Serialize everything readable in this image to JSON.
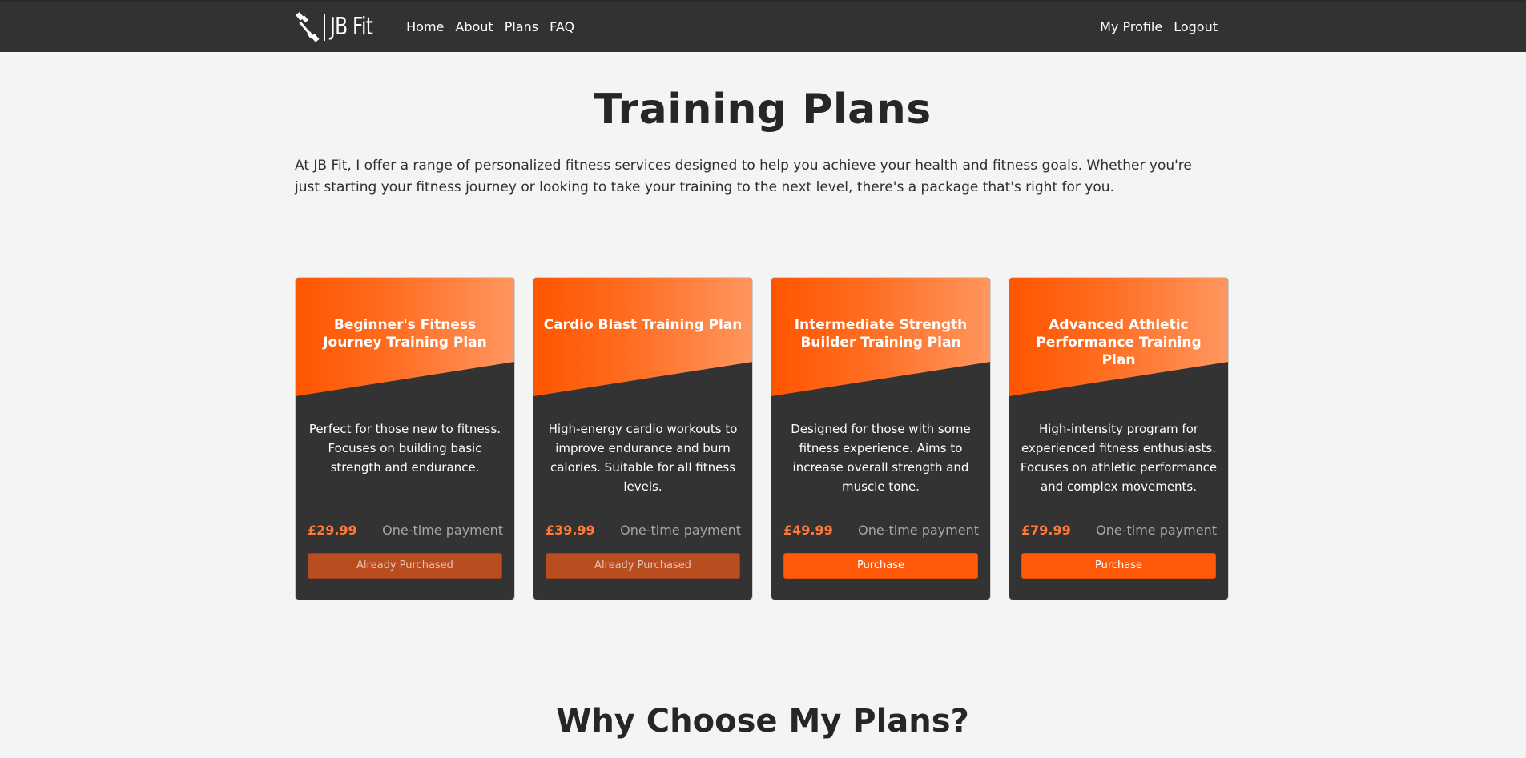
{
  "nav": {
    "logo_text": "JB Fit",
    "links": [
      "Home",
      "About",
      "Plans",
      "FAQ"
    ],
    "right_links": [
      "My Profile",
      "Logout"
    ]
  },
  "page": {
    "title": "Training Plans",
    "intro": "At JB Fit, I offer a range of personalized fitness services designed to help you achieve your health and fitness goals. Whether you're just starting your fitness journey or looking to take your training to the next level, there's a package that's right for you.",
    "section_title": "Why Choose My Plans?"
  },
  "plans": [
    {
      "title": "Beginner's Fitness Journey Training Plan",
      "description": "Perfect for those new to fitness. Focuses on building basic strength and endurance.",
      "price": "£29.99",
      "payment": "One-time payment",
      "button": "Already Purchased",
      "purchased": true
    },
    {
      "title": "Cardio Blast Training Plan",
      "description": "High-energy cardio workouts to improve endurance and burn calories. Suitable for all fitness levels.",
      "price": "£39.99",
      "payment": "One-time payment",
      "button": "Already Purchased",
      "purchased": true
    },
    {
      "title": "Intermediate Strength Builder Training Plan",
      "description": "Designed for those with some fitness experience. Aims to increase overall strength and muscle tone.",
      "price": "£49.99",
      "payment": "One-time payment",
      "button": "Purchase",
      "purchased": false
    },
    {
      "title": "Advanced Athletic Performance Training Plan",
      "description": "High-intensity program for experienced fitness enthusiasts. Focuses on athletic performance and complex movements.",
      "price": "£79.99",
      "payment": "One-time payment",
      "button": "Purchase",
      "purchased": false
    }
  ],
  "colors": {
    "nav_bg": "#333230",
    "accent": "#ff5a0a",
    "card_bg": "#333333",
    "price": "#ff7a3a",
    "purchased_btn": "#b94d1f"
  },
  "icons": {
    "logo": "dumbbell-icon"
  }
}
